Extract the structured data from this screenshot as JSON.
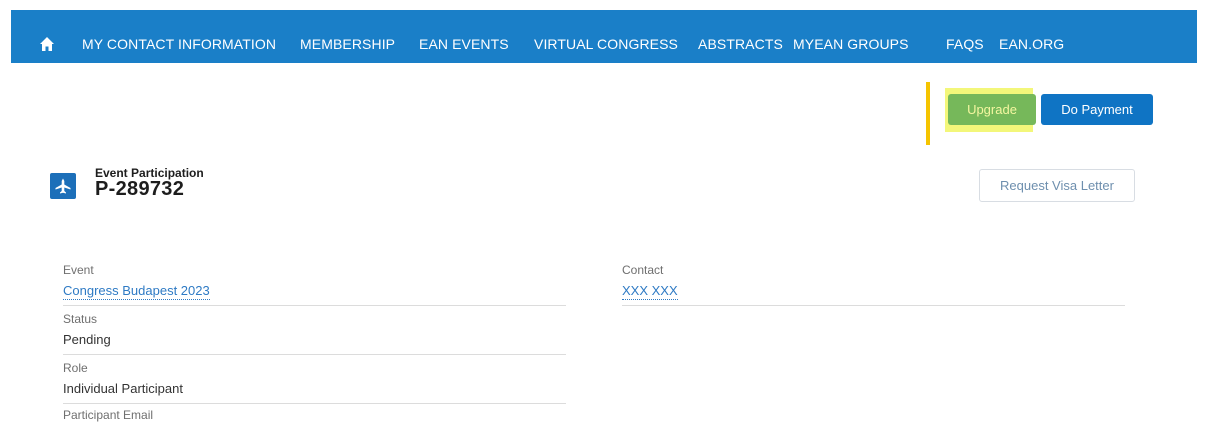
{
  "nav": {
    "home_icon": "home-icon",
    "items": [
      {
        "label": "MY CONTACT INFORMATION"
      },
      {
        "label": "MEMBERSHIP"
      },
      {
        "label": "EAN EVENTS"
      },
      {
        "label": "VIRTUAL CONGRESS"
      },
      {
        "label": "ABSTRACTS"
      },
      {
        "label": "MYEAN GROUPS"
      },
      {
        "label": "FAQS"
      },
      {
        "label": "EAN.ORG"
      }
    ]
  },
  "actions": {
    "upgrade_label": "Upgrade",
    "pay_label": "Do Payment",
    "visa_label": "Request Visa Letter"
  },
  "record": {
    "icon": "event-icon",
    "type": "Event Participation",
    "name": "P-289732"
  },
  "fields": {
    "event_label": "Event",
    "event_value": "Congress Budapest 2023",
    "status_label": "Status",
    "status_value": "Pending",
    "role_label": "Role",
    "role_value": "Individual Participant",
    "email_label": "Participant Email",
    "contact_label": "Contact",
    "contact_value": "XXX XXX"
  },
  "colors": {
    "nav_bg": "#1a7fc8",
    "upgrade_bg": "#76b85a",
    "pay_bg": "#0f74c4",
    "highlight": "#f3f77a",
    "marker": "#f5c400",
    "link": "#2e7ac4"
  }
}
